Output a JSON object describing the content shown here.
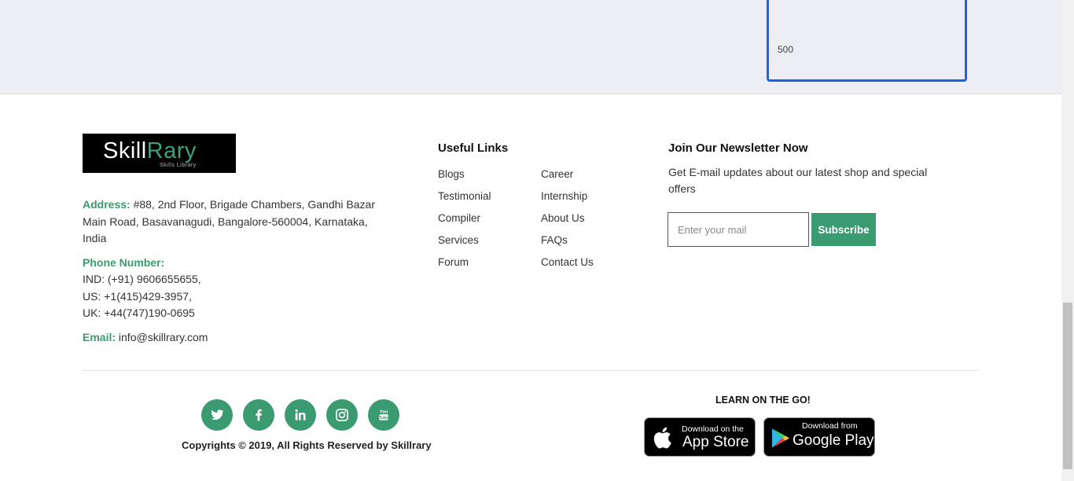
{
  "price_card": {
    "value": "500"
  },
  "brand": {
    "name_part1": "Skill",
    "name_part2": "Rary",
    "tagline": "Skills Library"
  },
  "contact": {
    "address_label": "Address:",
    "address_value": " #88, 2nd Floor, Brigade Chambers, Gandhi Bazar Main Road, Basavanagudi, Bangalore-560004, Karnataka, India",
    "phone_label": "Phone Number:",
    "phone_ind": "IND: (+91) 9606655655,",
    "phone_us": "US: +1(415)429-3957,",
    "phone_uk": "UK: +44(747)190-0695",
    "email_label": "Email:",
    "email_value": " info@skillrary.com"
  },
  "useful_links": {
    "title": "Useful Links",
    "col1": [
      "Blogs",
      "Testimonial",
      "Compiler",
      "Services",
      "Forum"
    ],
    "col2": [
      "Career",
      "Internship",
      "About Us",
      "FAQs",
      "Contact Us"
    ]
  },
  "newsletter": {
    "title": "Join Our Newsletter Now",
    "description": "Get E-mail updates about our latest shop and special offers",
    "placeholder": "Enter your mail",
    "button": "Subscribe"
  },
  "social": [
    "twitter-icon",
    "facebook-icon",
    "linkedin-icon",
    "instagram-icon",
    "youtube-icon"
  ],
  "copyright": "Copyrights © 2019, All Rights Reserved by Skillrary",
  "apps": {
    "heading": "LEARN ON THE GO!",
    "appstore_small": "Download on the",
    "appstore_big": "App Store",
    "googleplay_small": "Download from",
    "googleplay_big": "Google Play"
  },
  "colors": {
    "accent": "#3a9a70",
    "card_border": "#1a64e0"
  }
}
